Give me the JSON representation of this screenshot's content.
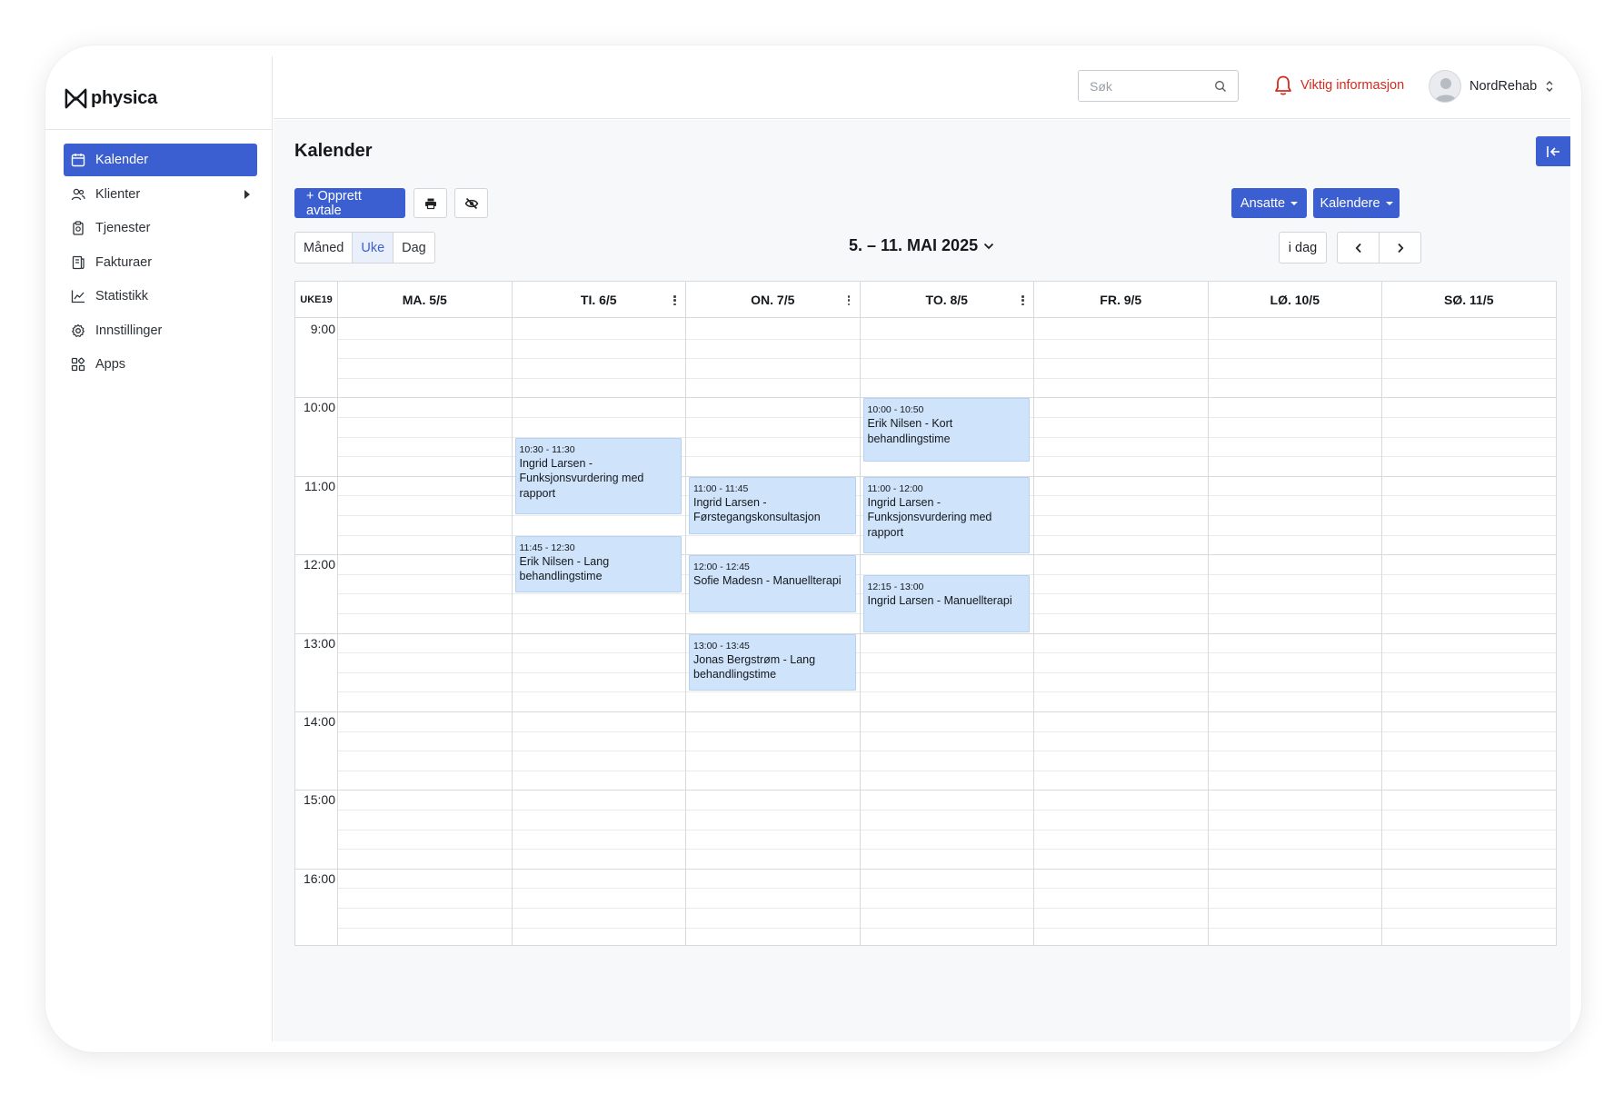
{
  "brand": {
    "name": "physica"
  },
  "sidebar": {
    "items": [
      {
        "label": "Kalender",
        "icon": "calendar-icon",
        "active": true
      },
      {
        "label": "Klienter",
        "icon": "users-icon"
      },
      {
        "label": "Tjenester",
        "icon": "clipboard-icon"
      },
      {
        "label": "Fakturaer",
        "icon": "invoice-icon"
      },
      {
        "label": "Statistikk",
        "icon": "chart-line-icon"
      },
      {
        "label": "Innstillinger",
        "icon": "gear-icon"
      },
      {
        "label": "Apps",
        "icon": "apps-icon"
      }
    ]
  },
  "topbar": {
    "search_placeholder": "Søk",
    "alert_label": "Viktig informasjon",
    "user_name": "NordRehab"
  },
  "colors": {
    "primary": "#3b5fd1",
    "alert": "#d42b1e",
    "event_bg": "#cfe3fb"
  },
  "page": {
    "title": "Kalender",
    "create_button": "+ Opprett avtale",
    "employees_button": "Ansatte",
    "calendars_button": "Kalendere",
    "views": [
      "Måned",
      "Uke",
      "Dag"
    ],
    "active_view": "Uke",
    "date_range": "5. – 11. MAI 2025",
    "today_button": "i dag"
  },
  "calendar": {
    "week_label": "UKE19",
    "days": [
      "MA. 5/5",
      "TI. 6/5",
      "ON. 7/5",
      "TO. 8/5",
      "FR. 9/5",
      "LØ. 10/5",
      "SØ. 11/5"
    ],
    "hours": [
      "9:00",
      "10:00",
      "11:00",
      "12:00",
      "13:00",
      "14:00",
      "15:00",
      "16:00"
    ],
    "events": [
      {
        "day": 1,
        "start": "10:30",
        "end": "11:30",
        "time": "10:30 - 11:30",
        "title": "Ingrid Larsen - Funksjonsvurdering med rapport"
      },
      {
        "day": 1,
        "start": "11:45",
        "end": "12:30",
        "time": "11:45 - 12:30",
        "title": "Erik Nilsen - Lang behandlingstime"
      },
      {
        "day": 2,
        "start": "11:00",
        "end": "11:45",
        "time": "11:00 - 11:45",
        "title": "Ingrid Larsen - Førstegangskonsultasjon"
      },
      {
        "day": 2,
        "start": "12:00",
        "end": "12:45",
        "time": "12:00 - 12:45",
        "title": "Sofie Madesn - Manuellterapi"
      },
      {
        "day": 2,
        "start": "13:00",
        "end": "13:45",
        "time": "13:00 - 13:45",
        "title": "Jonas Bergstrøm - Lang behandlingstime"
      },
      {
        "day": 3,
        "start": "10:00",
        "end": "10:50",
        "time": "10:00 - 10:50",
        "title": "Erik Nilsen - Kort behandlingstime"
      },
      {
        "day": 3,
        "start": "11:00",
        "end": "12:00",
        "time": "11:00 - 12:00",
        "title": "Ingrid Larsen - Funksjonsvurdering med rapport"
      },
      {
        "day": 3,
        "start": "12:15",
        "end": "13:00",
        "time": "12:15 - 13:00",
        "title": "Ingrid Larsen - Manuellterapi"
      }
    ]
  }
}
